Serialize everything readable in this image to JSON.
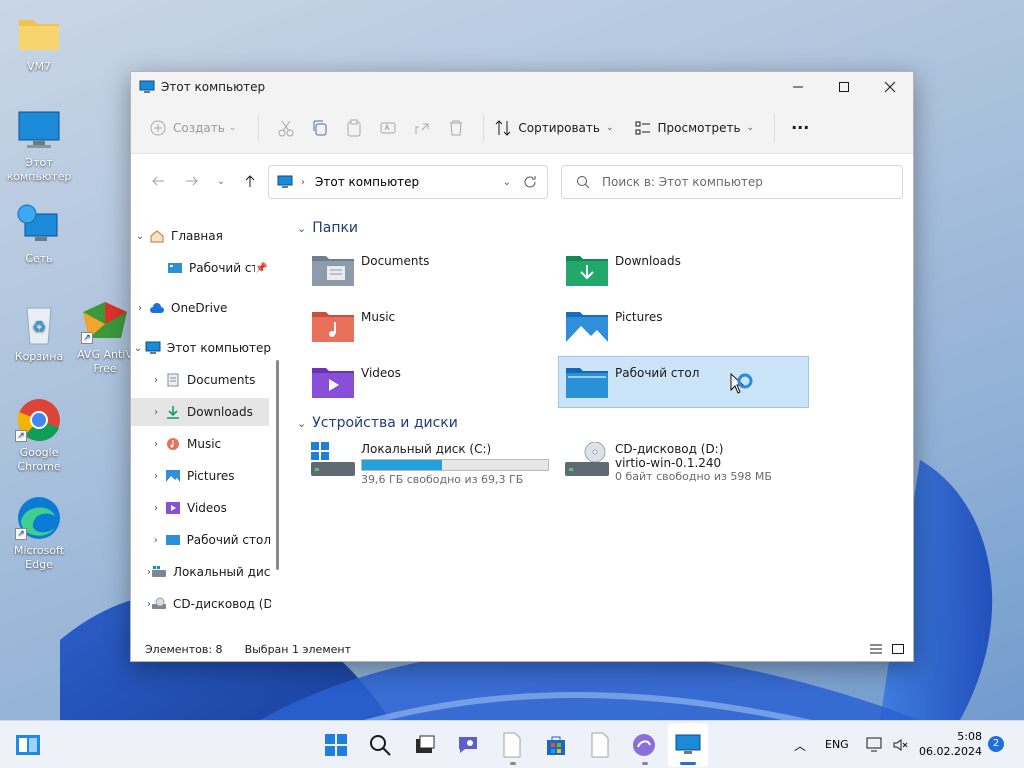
{
  "desktop": {
    "icons": [
      {
        "label": "VM7"
      },
      {
        "label": "Этот компьютер"
      },
      {
        "label": "Сеть"
      },
      {
        "label": "Корзина"
      },
      {
        "label": "AVG AntiV Free"
      },
      {
        "label": "Google Chrome"
      },
      {
        "label": "Microsoft Edge"
      }
    ]
  },
  "window": {
    "title": "Этот компьютер",
    "toolbar": {
      "create": "Создать",
      "sort": "Сортировать",
      "view": "Просмотреть",
      "more": "···"
    },
    "address": {
      "path": "Этот компьютер",
      "search_placeholder": "Поиск в: Этот компьютер"
    },
    "nav": {
      "items": [
        {
          "label": "Главная"
        },
        {
          "label": "Рабочий стол"
        },
        {
          "label": "OneDrive"
        },
        {
          "label": "Этот компьютер"
        },
        {
          "label": "Documents"
        },
        {
          "label": "Downloads"
        },
        {
          "label": "Music"
        },
        {
          "label": "Pictures"
        },
        {
          "label": "Videos"
        },
        {
          "label": "Рабочий стол"
        },
        {
          "label": "Локальный диск (C:)"
        },
        {
          "label": "CD-дисковод (D:)"
        }
      ]
    },
    "sections": {
      "folders": "Папки",
      "devices": "Устройства и диски"
    },
    "folders": [
      {
        "name": "Documents"
      },
      {
        "name": "Downloads"
      },
      {
        "name": "Music"
      },
      {
        "name": "Pictures"
      },
      {
        "name": "Videos"
      },
      {
        "name": "Рабочий стол"
      }
    ],
    "drives": [
      {
        "name": "Локальный диск (C:)",
        "free": "39,6 ГБ свободно из 69,3 ГБ",
        "used_fraction": 0.43
      },
      {
        "name": "CD-дисковод (D:)",
        "label": "virtio-win-0.1.240",
        "free": "0 байт свободно из 598 МБ"
      }
    ],
    "status": {
      "count": "Элементов: 8",
      "selected": "Выбран 1 элемент"
    }
  },
  "taskbar": {
    "lang": "ENG",
    "time": "5:08",
    "date": "06.02.2024",
    "notifications": "2"
  }
}
